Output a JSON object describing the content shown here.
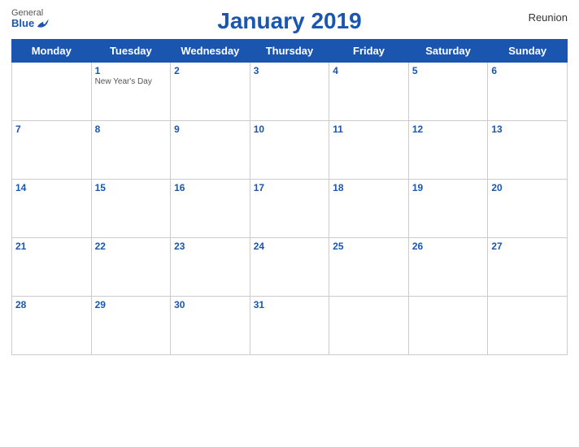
{
  "header": {
    "logo_general": "General",
    "logo_blue": "Blue",
    "title": "January 2019",
    "region": "Reunion"
  },
  "weekdays": [
    "Monday",
    "Tuesday",
    "Wednesday",
    "Thursday",
    "Friday",
    "Saturday",
    "Sunday"
  ],
  "weeks": [
    [
      {
        "day": "",
        "empty": true
      },
      {
        "day": "1",
        "holiday": "New Year's Day"
      },
      {
        "day": "2"
      },
      {
        "day": "3"
      },
      {
        "day": "4"
      },
      {
        "day": "5"
      },
      {
        "day": "6"
      }
    ],
    [
      {
        "day": "7"
      },
      {
        "day": "8"
      },
      {
        "day": "9"
      },
      {
        "day": "10"
      },
      {
        "day": "11"
      },
      {
        "day": "12"
      },
      {
        "day": "13"
      }
    ],
    [
      {
        "day": "14"
      },
      {
        "day": "15"
      },
      {
        "day": "16"
      },
      {
        "day": "17"
      },
      {
        "day": "18"
      },
      {
        "day": "19"
      },
      {
        "day": "20"
      }
    ],
    [
      {
        "day": "21"
      },
      {
        "day": "22"
      },
      {
        "day": "23"
      },
      {
        "day": "24"
      },
      {
        "day": "25"
      },
      {
        "day": "26"
      },
      {
        "day": "27"
      }
    ],
    [
      {
        "day": "28"
      },
      {
        "day": "29"
      },
      {
        "day": "30"
      },
      {
        "day": "31"
      },
      {
        "day": ""
      },
      {
        "day": ""
      },
      {
        "day": ""
      }
    ]
  ]
}
